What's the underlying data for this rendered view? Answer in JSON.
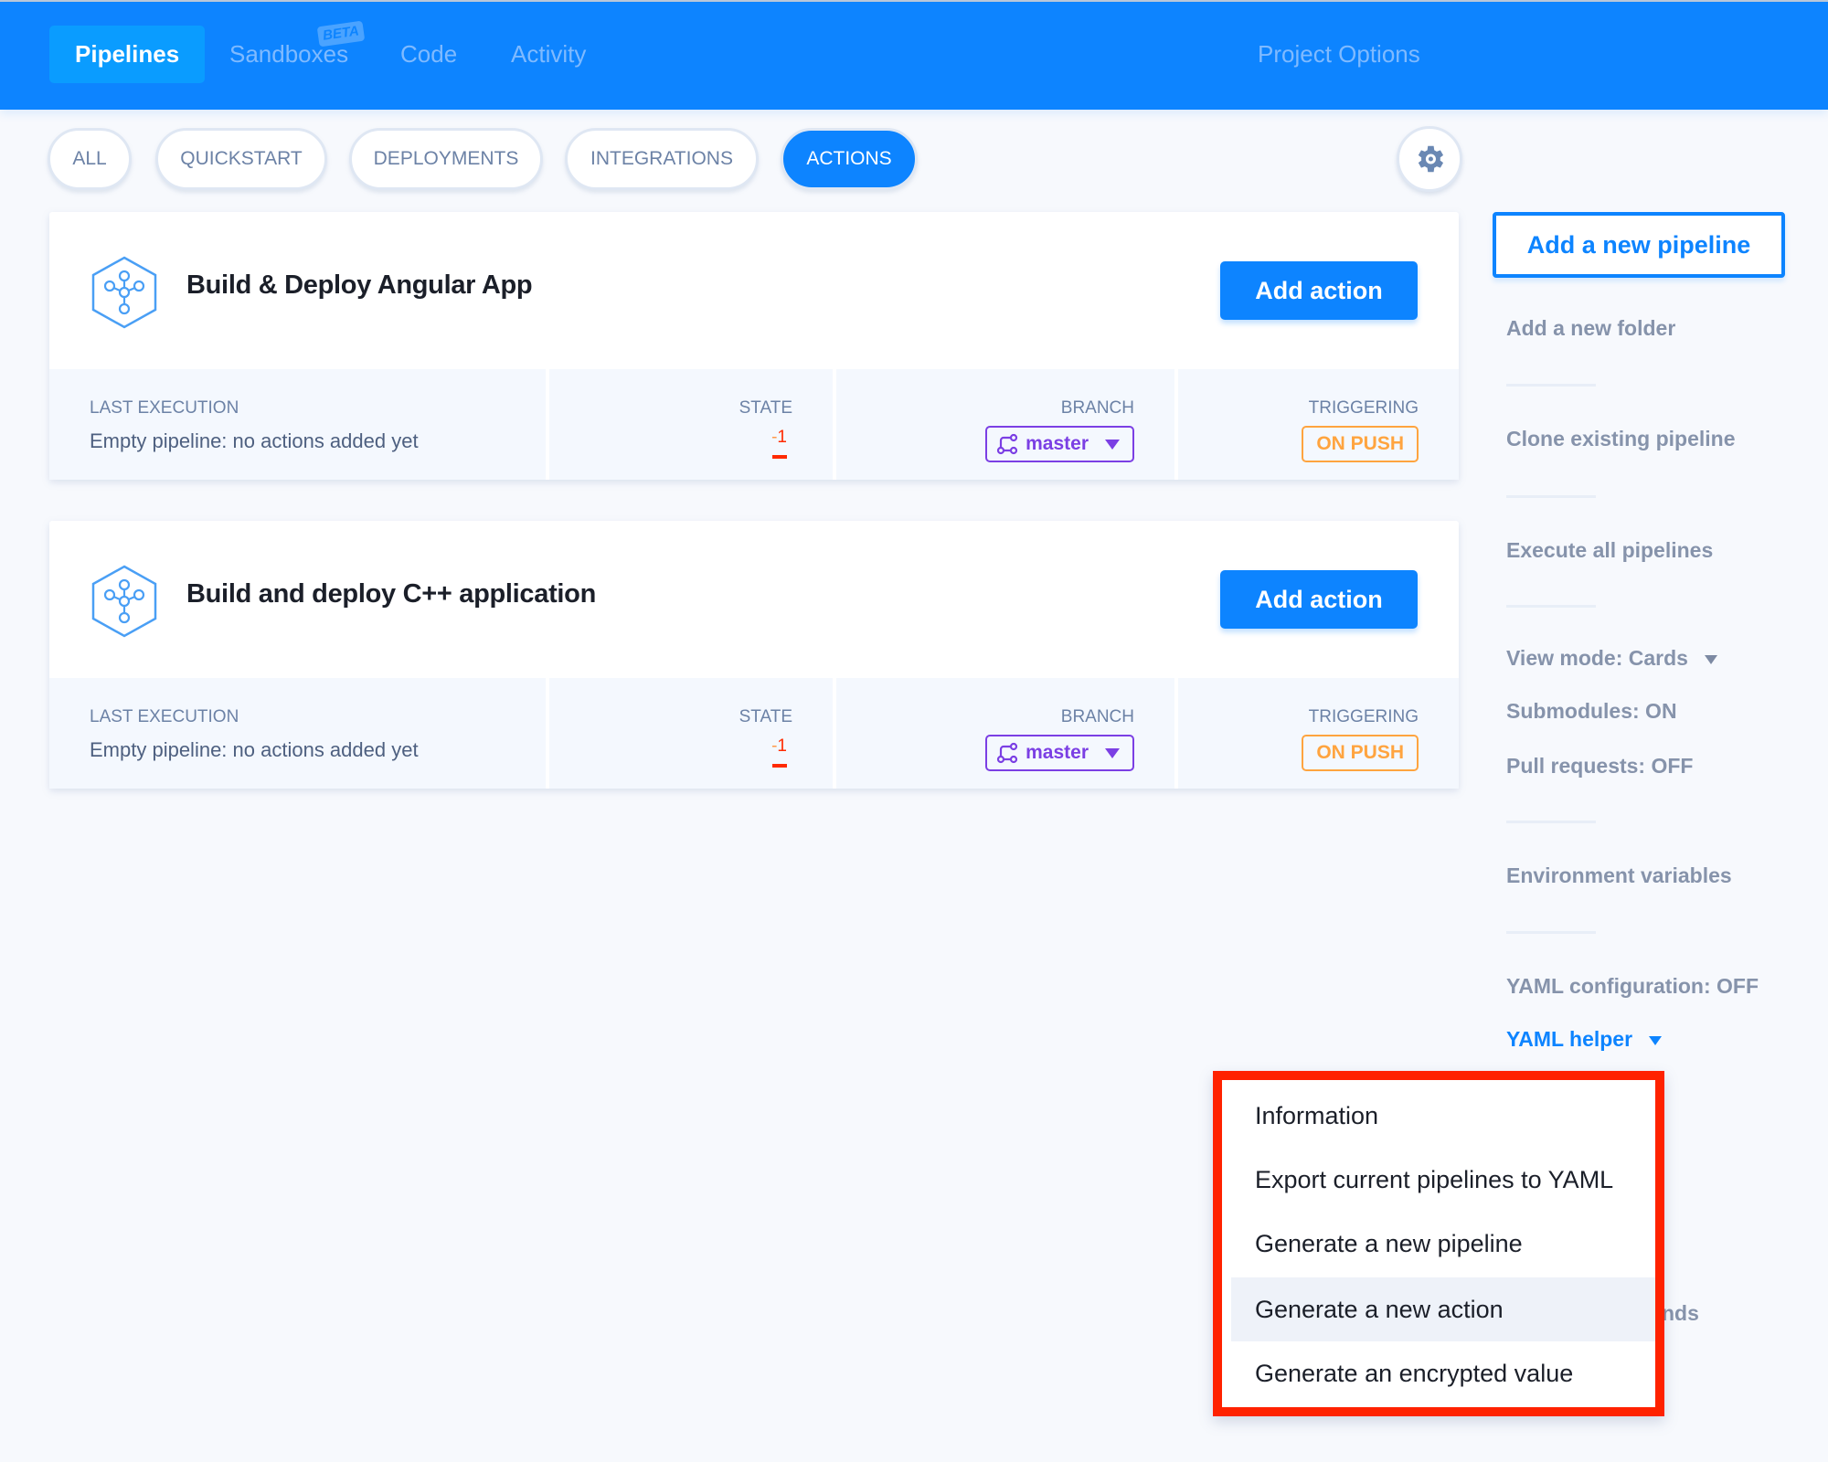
{
  "header": {
    "tabs": [
      {
        "label": "Pipelines",
        "active": true
      },
      {
        "label": "Sandboxes",
        "badge": "BETA"
      },
      {
        "label": "Code"
      },
      {
        "label": "Activity"
      }
    ],
    "project_options": "Project Options"
  },
  "filters": {
    "pills": [
      "ALL",
      "QUICKSTART",
      "DEPLOYMENTS",
      "INTEGRATIONS",
      "ACTIONS"
    ],
    "active": "ACTIONS",
    "settings_icon": "gear-icon"
  },
  "pipelines": [
    {
      "title": "Build & Deploy Angular App",
      "add_action_label": "Add action",
      "last_execution_label": "LAST EXECUTION",
      "last_execution_value": "Empty pipeline: no actions added yet",
      "state_label": "STATE",
      "state_value_dash": "-",
      "state_value": "1",
      "branch_label": "BRANCH",
      "branch_value": "master",
      "triggering_label": "TRIGGERING",
      "triggering_value": "ON PUSH"
    },
    {
      "title": "Build and deploy C++ application",
      "add_action_label": "Add action",
      "last_execution_label": "LAST EXECUTION",
      "last_execution_value": "Empty pipeline: no actions added yet",
      "state_label": "STATE",
      "state_value_dash": "-",
      "state_value": "1",
      "branch_label": "BRANCH",
      "branch_value": "master",
      "triggering_label": "TRIGGERING",
      "triggering_value": "ON PUSH"
    }
  ],
  "sidebar": {
    "add_pipeline": "Add a new pipeline",
    "add_folder": "Add a new folder",
    "clone": "Clone existing pipeline",
    "execute_all": "Execute all pipelines",
    "view_mode": "View mode: Cards",
    "submodules": "Submodules: ON",
    "pull_requests": "Pull requests: OFF",
    "env_vars": "Environment variables",
    "yaml_config": "YAML configuration: OFF",
    "yaml_helper": "YAML helper",
    "obscured_item_fragment": "nds"
  },
  "yaml_helper_menu": {
    "items": [
      "Information",
      "Export current pipelines to YAML",
      "Generate a new pipeline",
      "Generate a new action",
      "Generate an encrypted value"
    ],
    "hovered_index": 3
  },
  "colors": {
    "primary": "#0d84ff",
    "branch": "#7b3fe4",
    "trigger": "#ffa43f",
    "state_error": "#ff2a00",
    "highlight_box": "#ff2200"
  }
}
